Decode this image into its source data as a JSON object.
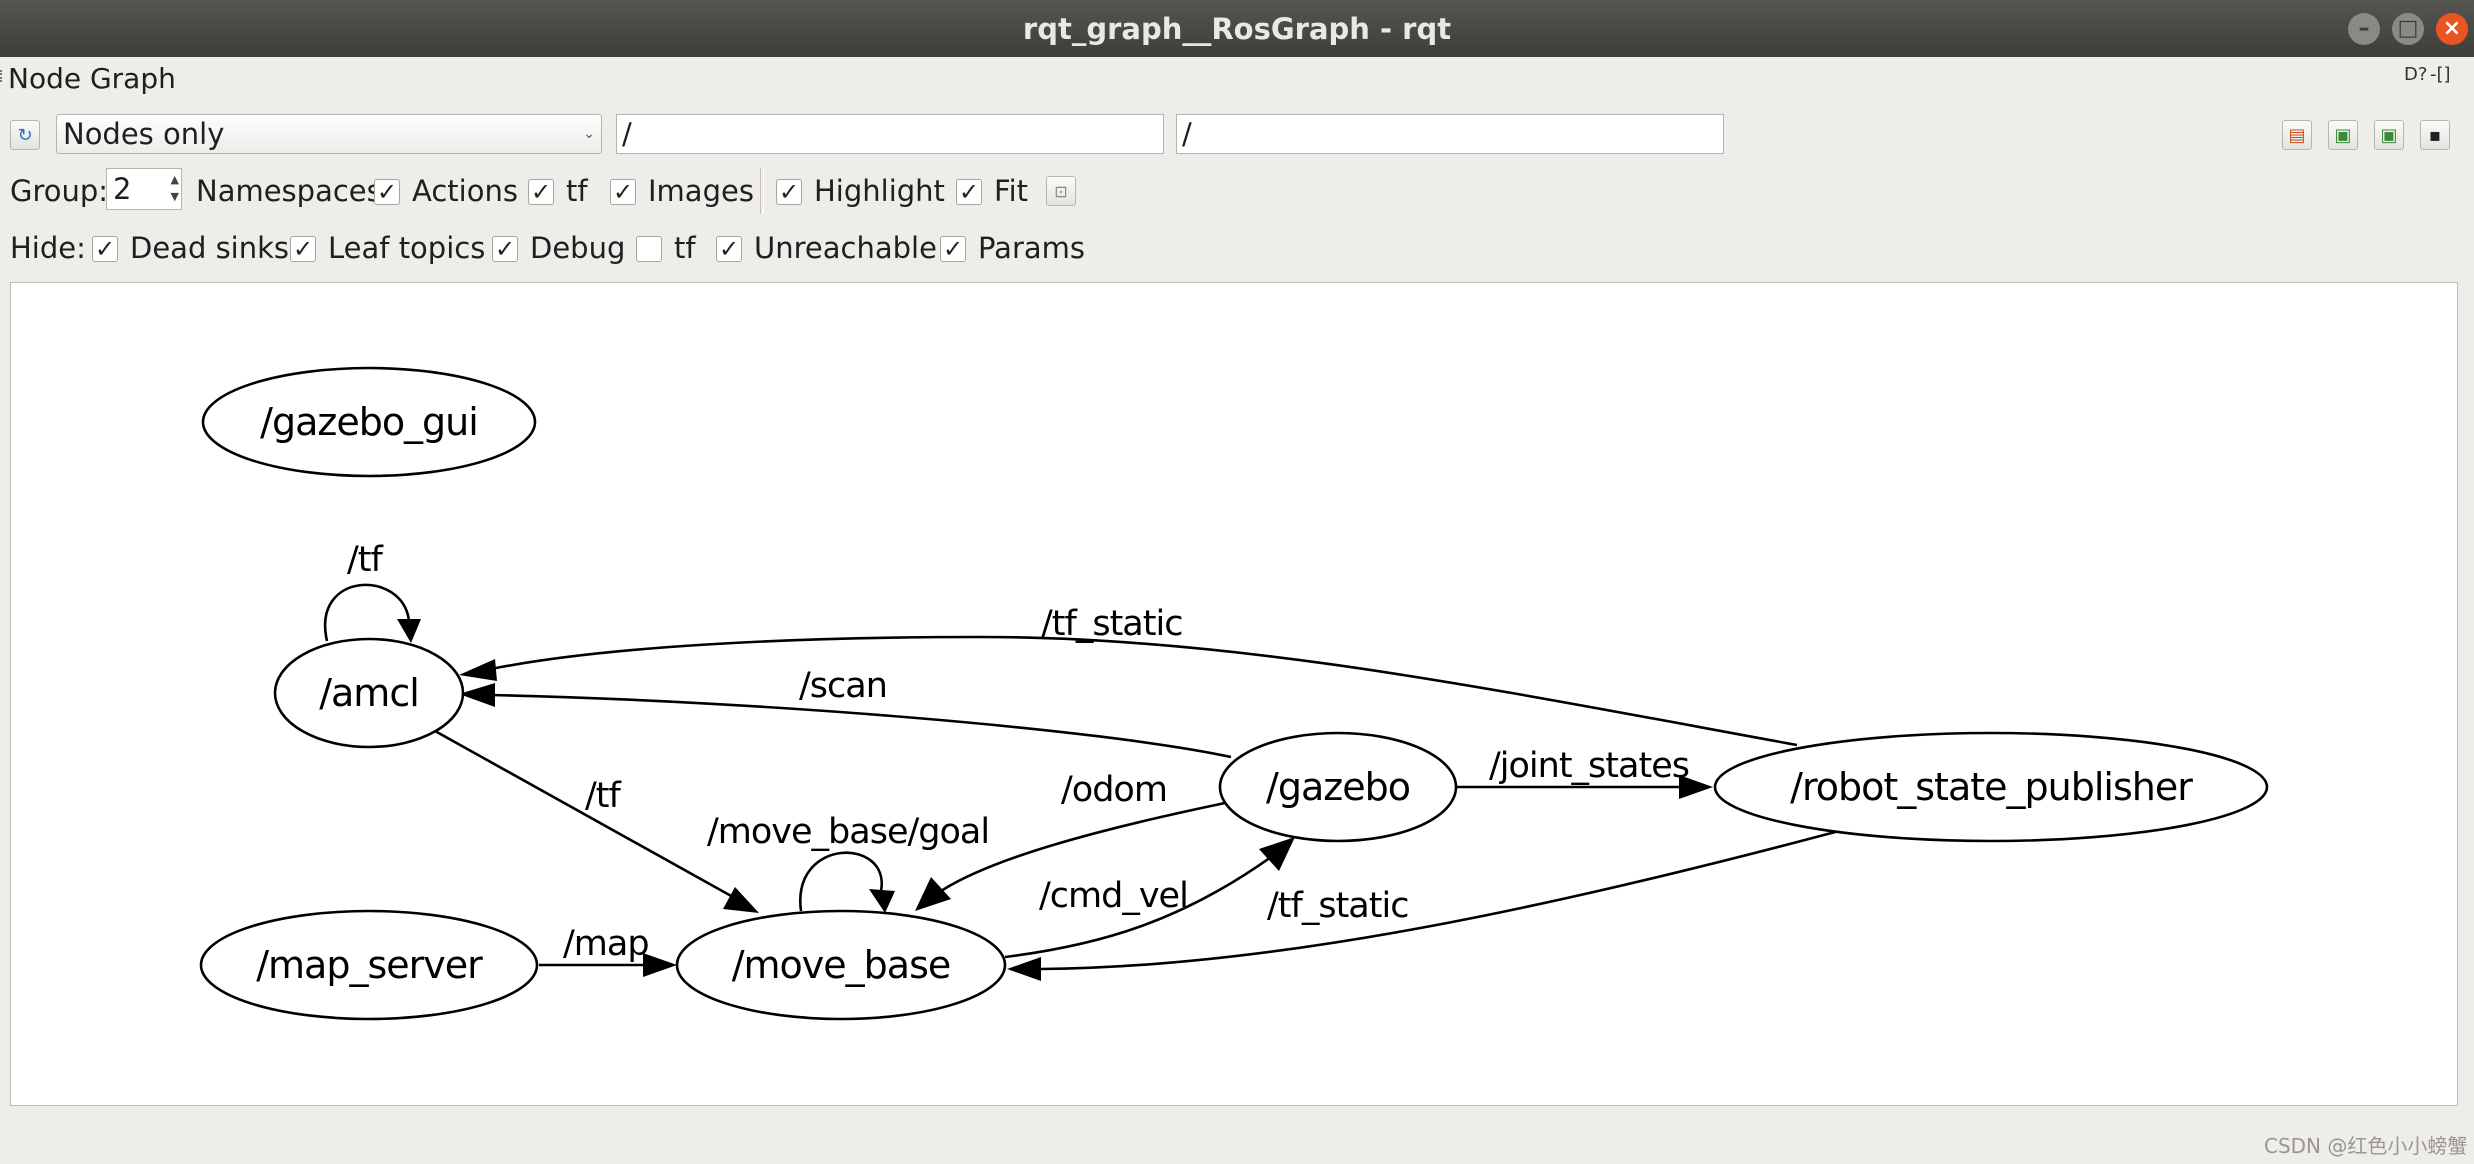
{
  "window": {
    "title": "rqt_graph__RosGraph - rqt"
  },
  "dock": {
    "title": "Node Graph",
    "help_icon": "D?",
    "float_icon": "-[]"
  },
  "toolbar": {
    "mode": "Nodes only",
    "namespace_filter": "/",
    "topic_filter": "/"
  },
  "options": {
    "group_label": "Group:",
    "group_value": "2",
    "namespaces": {
      "label": "Namespaces",
      "checked": true
    },
    "actions": {
      "label": "Actions",
      "checked": true
    },
    "tf": {
      "label": "tf",
      "checked": true
    },
    "images": {
      "label": "Images",
      "checked": true
    },
    "highlight": {
      "label": "Highlight",
      "checked": true
    },
    "fit": {
      "label": "Fit",
      "checked": true
    }
  },
  "hide": {
    "label": "Hide:",
    "dead_sinks": {
      "label": "Dead sinks",
      "checked": true
    },
    "leaf_topics": {
      "label": "Leaf topics",
      "checked": true
    },
    "debug": {
      "label": "Debug",
      "checked": true
    },
    "tf": {
      "label": "tf",
      "checked": false
    },
    "unreachable": {
      "label": "Unreachable",
      "checked": true
    },
    "params": {
      "label": "Params",
      "checked": true
    }
  },
  "graph": {
    "nodes": {
      "gazebo_gui": "/gazebo_gui",
      "amcl": "/amcl",
      "gazebo": "/gazebo",
      "robot_state_publisher": "/robot_state_publisher",
      "map_server": "/map_server",
      "move_base": "/move_base"
    },
    "edges": {
      "amcl_self_tf": "/tf",
      "rsp_to_amcl": "/tf_static",
      "gazebo_to_amcl": "/scan",
      "amcl_to_move_base": "/tf",
      "gazebo_to_move_base": "/odom",
      "move_base_self": "/move_base/goal",
      "gazebo_to_rsp": "/joint_states",
      "move_base_to_gazebo": "/cmd_vel",
      "rsp_to_move_base": "/tf_static",
      "map_server_to_move_base": "/map"
    }
  },
  "watermark": "CSDN @红色小小螃蟹"
}
